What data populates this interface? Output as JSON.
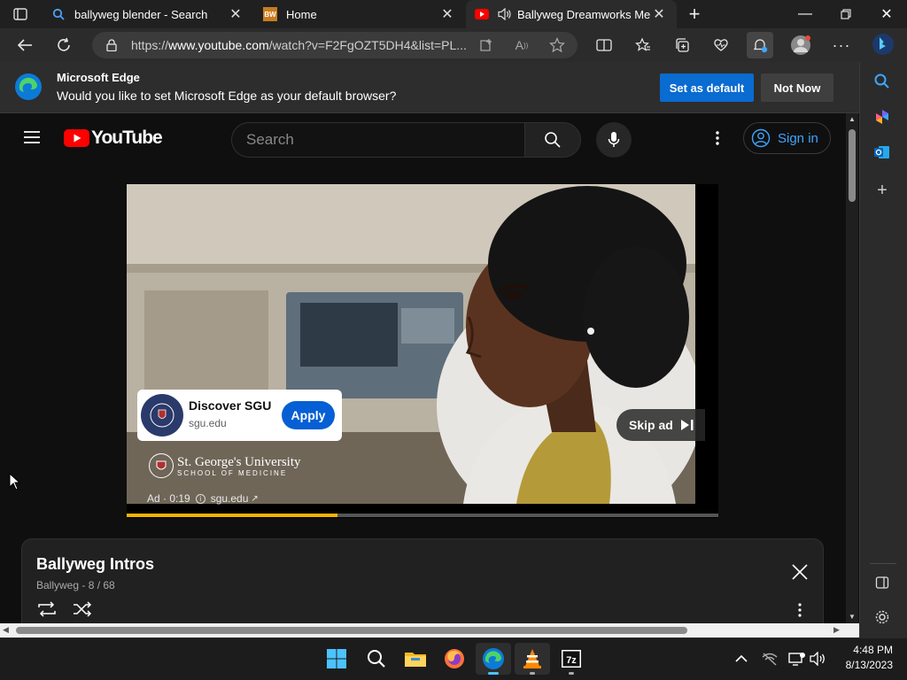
{
  "tabs": [
    {
      "title": "ballyweg blender - Search",
      "icon": "search-icon"
    },
    {
      "title": "Home",
      "icon": "bw-favicon"
    },
    {
      "title": "Ballyweg Dreamworks Meg",
      "icon": "youtube-favicon",
      "active": true
    }
  ],
  "address": {
    "scheme": "https://",
    "host": "www.youtube.com",
    "path": "/watch?v=F2FgOZT5DH4&list=PL..."
  },
  "infobar": {
    "title": "Microsoft Edge",
    "message": "Would you like to set Microsoft Edge as your default browser?",
    "primary": "Set as default",
    "secondary": "Not Now"
  },
  "youtube": {
    "logo_text": "YouTube",
    "search_placeholder": "Search",
    "sign_in": "Sign in"
  },
  "ad": {
    "card_title": "Discover SGU",
    "card_domain": "sgu.edu",
    "apply": "Apply",
    "brand_name": "St. George's University",
    "brand_sub": "SCHOOL OF MEDICINE",
    "ad_label": "Ad · 0:19",
    "ad_domain": "sgu.edu",
    "skip": "Skip ad",
    "progress": 0.356
  },
  "playlist": {
    "title": "Ballyweg Intros",
    "meta": "Ballyweg - 8 / 68"
  },
  "taskbar": {
    "time": "4:48 PM",
    "date": "8/13/2023"
  },
  "colors": {
    "accent": "#0a6bd1",
    "youtube_red": "#ff0000",
    "link_blue": "#3ea6ff",
    "progress_yellow": "#f4b400"
  }
}
